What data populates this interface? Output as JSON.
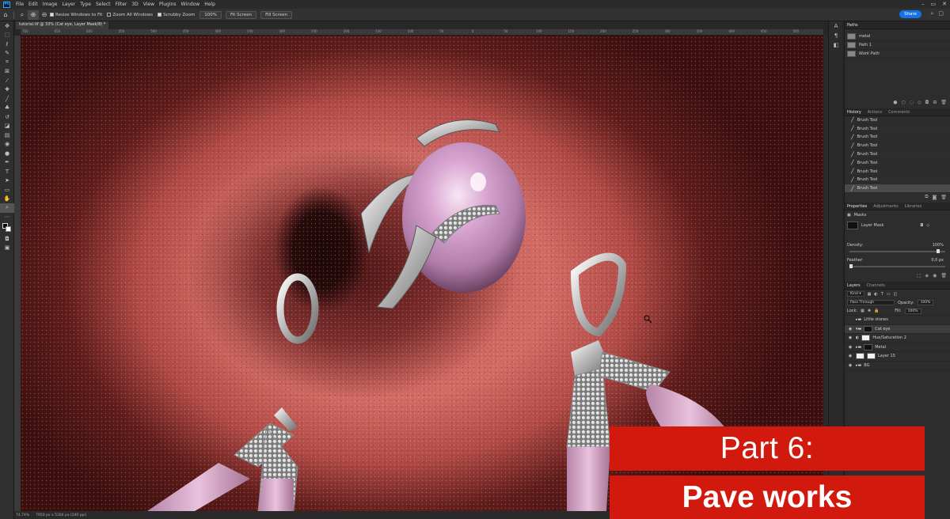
{
  "menubar": {
    "app_icon": "Ps",
    "items": [
      "File",
      "Edit",
      "Image",
      "Layer",
      "Type",
      "Select",
      "Filter",
      "3D",
      "View",
      "Plugins",
      "Window",
      "Help"
    ]
  },
  "options": {
    "resize_windows": "Resize Windows to Fit",
    "zoom_all": "Zoom All Windows",
    "scrubby_zoom": "Scrubby Zoom",
    "zoom_100": "100%",
    "fit_screen": "Fit Screen",
    "fill_screen": "Fill Screen",
    "share": "Share"
  },
  "document": {
    "tab_title": "tutorial.tif @ 33% (Cat eye, Layer Mask/8) *",
    "ruler_labels": [
      "700",
      "650",
      "600",
      "550",
      "500",
      "450",
      "400",
      "350",
      "300",
      "250",
      "200",
      "150",
      "100",
      "50",
      "0",
      "50",
      "100",
      "150",
      "200",
      "250",
      "300",
      "350",
      "400",
      "450",
      "500"
    ],
    "status_zoom": "74,74%",
    "status_size": "7950 px x 5304 px (240 ppi)"
  },
  "overlay": {
    "line1": "Part 6:",
    "line2": "Pave works",
    "color": "#d1190e"
  },
  "paths_panel": {
    "title": "Paths",
    "items": [
      "metal",
      "Path 1",
      "Work Path"
    ]
  },
  "history_panel": {
    "tabs": [
      "History",
      "Actions",
      "Comments"
    ],
    "items": [
      "Brush Tool",
      "Brush Tool",
      "Brush Tool",
      "Brush Tool",
      "Brush Tool",
      "Brush Tool",
      "Brush Tool",
      "Brush Tool",
      "Brush Tool"
    ]
  },
  "properties_panel": {
    "tabs": [
      "Properties",
      "Adjustments",
      "Libraries"
    ],
    "masks_label": "Masks",
    "layer_mask_label": "Layer Mask",
    "density_label": "Density:",
    "density_value": "100%",
    "feather_label": "Feather:",
    "feather_value": "0,0 px",
    "density_level": 1.0,
    "feather_level": 0.0
  },
  "layers_panel": {
    "tabs": [
      "Layers",
      "Channels"
    ],
    "kind": "Kind",
    "blend_mode": "Pass Through",
    "opacity_label": "Opacity:",
    "opacity_value": "100%",
    "lock_label": "Lock:",
    "fill_label": "Fill:",
    "fill_value": "100%",
    "layers": [
      "Little stones",
      "Cat eye",
      "Hue/Saturation 2",
      "Metal",
      "Layer 15",
      "BG"
    ]
  }
}
